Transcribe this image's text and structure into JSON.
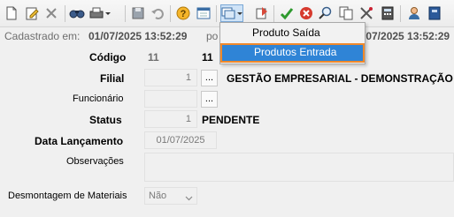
{
  "header": {
    "cadastrado_label": "Cadastrado em:",
    "cadastrado_value": "01/07/2025 13:52:29",
    "por_label": "po",
    "alterado_value": "/07/2025 13:52:29"
  },
  "toolbar": {
    "icons": [
      "new-document-icon",
      "edit-icon",
      "delete-icon",
      "find-icon",
      "print-icon",
      "save-icon",
      "undo-icon",
      "help-icon",
      "calendar-icon",
      "copy-dropdown-icon",
      "export-icon",
      "approve-icon",
      "cancel-icon",
      "search-icon",
      "duplicate-icon",
      "tools-icon",
      "calculator-icon",
      "user-icon",
      "book-icon"
    ]
  },
  "menu": {
    "items": [
      {
        "label": "Produto Saída"
      },
      {
        "label": "Produtos Entrada"
      }
    ]
  },
  "form": {
    "codigo": {
      "label": "Código",
      "value": "11",
      "value_right": "11"
    },
    "filial": {
      "label": "Filial",
      "code": "1",
      "button": "...",
      "name": "GESTÃO EMPRESARIAL - DEMONSTRAÇÃO"
    },
    "funcionario": {
      "label": "Funcionário",
      "code": "",
      "button": "..."
    },
    "status": {
      "label": "Status",
      "code": "1",
      "name": "PENDENTE"
    },
    "data_lancamento": {
      "label": "Data Lançamento",
      "value": "01/07/2025"
    },
    "observacoes": {
      "label": "Observações",
      "value": ""
    },
    "desmontagem": {
      "label": "Desmontagem de Materiais",
      "value": "Não"
    }
  },
  "colors": {
    "highlight": "#2f84d6",
    "highlight_border": "#f0892b"
  }
}
